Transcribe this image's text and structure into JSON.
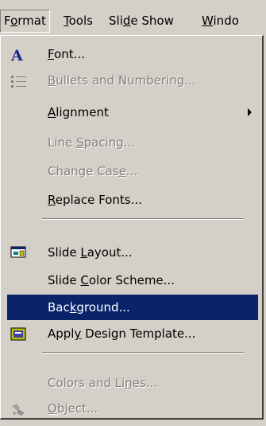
{
  "menubar": {
    "items": [
      {
        "label": "Format",
        "accel": "o"
      },
      {
        "label": "Tools",
        "accel": "T"
      },
      {
        "label": "Slide Show",
        "accel": "d"
      },
      {
        "label": "Windo",
        "accel": "W"
      }
    ]
  },
  "menu": {
    "items": [
      {
        "label": "Font...",
        "icon": "font-a-icon",
        "enabled": true
      },
      {
        "label": "Bullets and Numbering...",
        "icon": "bullets-icon",
        "enabled": false
      },
      {
        "label": "Alignment",
        "has_submenu": true,
        "enabled": true
      },
      {
        "label": "Line Spacing...",
        "enabled": false
      },
      {
        "label": "Change Case...",
        "enabled": false
      },
      {
        "label": "Replace Fonts...",
        "enabled": true
      },
      {
        "label": "Slide Layout...",
        "icon": "slide-layout-icon",
        "enabled": true
      },
      {
        "label": "Slide Color Scheme...",
        "enabled": true
      },
      {
        "label": "Background...",
        "enabled": true,
        "highlighted": true
      },
      {
        "label": "Apply Design Template...",
        "icon": "design-template-icon",
        "enabled": true
      },
      {
        "label": "Colors and Lines...",
        "enabled": false
      },
      {
        "label": "Object...",
        "icon": "object-icon",
        "enabled": false
      }
    ]
  },
  "colors": {
    "menu_bg": "#d4d0c8",
    "highlight": "#0a246a",
    "disabled_text": "#808080",
    "font_icon": "#1a2a8a"
  }
}
